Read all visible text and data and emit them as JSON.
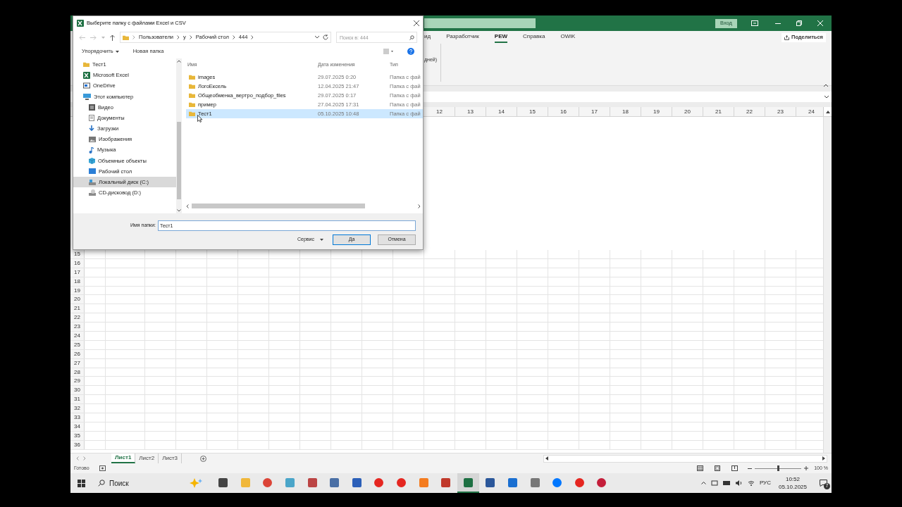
{
  "excel": {
    "sign_in": "Вход",
    "tabs": [
      {
        "label": "ид",
        "selected": false
      },
      {
        "label": "Разработчик",
        "selected": false
      },
      {
        "label": "PEW",
        "selected": true
      },
      {
        "label": "Справка",
        "selected": false
      },
      {
        "label": "OWiK",
        "selected": false
      }
    ],
    "ribbon_text": "дней)",
    "share": "Поделиться",
    "columns": [
      "12",
      "13",
      "14",
      "15",
      "16",
      "17",
      "18",
      "19",
      "20",
      "21",
      "22",
      "23",
      "24"
    ],
    "rows": [
      "15",
      "16",
      "17",
      "18",
      "19",
      "20",
      "21",
      "22",
      "23",
      "24",
      "25",
      "26",
      "27",
      "28",
      "29",
      "30",
      "31",
      "32",
      "33",
      "34",
      "35",
      "36"
    ],
    "sheets": [
      {
        "label": "Лист1",
        "selected": true
      },
      {
        "label": "Лист2",
        "selected": false
      },
      {
        "label": "Лист3",
        "selected": false
      }
    ],
    "status": "Готово",
    "zoom": {
      "level": 0.5,
      "reading": "100 %"
    }
  },
  "dialog": {
    "title": "Выберите папку с файлами Excel и CSV",
    "breadcrumb": [
      "Пользователи",
      "у",
      "Рабочий стол",
      "444"
    ],
    "search": {
      "placeholder": "Поиск в: 444"
    },
    "organize": "Упорядочить",
    "new_folder": "Новая папка",
    "nav": [
      {
        "label": "Тест1",
        "kind": "folder",
        "selected": false
      },
      {
        "label": "Microsoft Excel",
        "kind": "excel",
        "selected": false
      },
      {
        "label": "OneDrive",
        "kind": "cloud",
        "selected": false
      },
      {
        "label": "Этот компьютер",
        "kind": "computer",
        "selected": false,
        "children": [
          {
            "label": "Видео",
            "kind": "video",
            "selected": false
          },
          {
            "label": "Документы",
            "kind": "document",
            "selected": false
          },
          {
            "label": "Загрузки",
            "kind": "download",
            "selected": false
          },
          {
            "label": "Изображения",
            "kind": "image",
            "selected": false
          },
          {
            "label": "Музыка",
            "kind": "music",
            "selected": false
          },
          {
            "label": "Объемные объекты",
            "kind": "cube",
            "selected": false
          },
          {
            "label": "Рабочий стол",
            "kind": "desktop",
            "selected": false
          },
          {
            "label": "Локальный диск (C:)",
            "kind": "disk",
            "selected": true
          },
          {
            "label": "CD-дисковод (D:)",
            "kind": "cd",
            "selected": false
          }
        ]
      }
    ],
    "columns": [
      "Имя",
      "Дата изменения",
      "Тип"
    ],
    "files": [
      {
        "name": "images",
        "modified": "29.07.2025 0:20",
        "type": "Папка с фай",
        "selected": false
      },
      {
        "name": "ЛогоЕксель",
        "modified": "12.04.2025 21:47",
        "type": "Папка с фай",
        "selected": false
      },
      {
        "name": "Общеобменка_вертро_подбор_files",
        "modified": "29.07.2025 0:17",
        "type": "Папка с фай",
        "selected": false
      },
      {
        "name": "пример",
        "modified": "27.04.2025 17:31",
        "type": "Папка с фай",
        "selected": false
      },
      {
        "name": "Тест1",
        "modified": "05.10.2025 10:48",
        "type": "Папка с фай",
        "selected": true
      }
    ],
    "folder_name": {
      "label": "Имя папки:",
      "value": "Тест1"
    },
    "buttons": [
      {
        "label": "Сервис",
        "kind": "menu"
      },
      {
        "label": "Да",
        "kind": "primary"
      },
      {
        "label": "Отмена",
        "kind": "default"
      }
    ]
  },
  "taskbar": {
    "search": "Поиск",
    "apps": [
      {
        "kind": "taskview",
        "selected": false
      },
      {
        "kind": "explorer",
        "selected": false
      },
      {
        "kind": "chrome",
        "selected": false
      },
      {
        "kind": "notes",
        "selected": false
      },
      {
        "kind": "paint",
        "selected": false
      },
      {
        "kind": "calculator",
        "selected": false
      },
      {
        "kind": "monitor",
        "selected": false
      },
      {
        "kind": "yandex",
        "selected": false
      },
      {
        "kind": "redcircle",
        "selected": false
      },
      {
        "kind": "xampp",
        "selected": false
      },
      {
        "kind": "tool",
        "selected": false
      },
      {
        "kind": "excel",
        "selected": true
      },
      {
        "kind": "word",
        "selected": false
      },
      {
        "kind": "crop",
        "selected": false
      },
      {
        "kind": "printer",
        "selected": false
      },
      {
        "kind": "vk",
        "selected": false
      },
      {
        "kind": "yandex",
        "selected": false
      },
      {
        "kind": "ring",
        "selected": false
      }
    ],
    "lang": "РУС",
    "time": "10:52",
    "date": "05.10.2025",
    "notifications": "7"
  }
}
